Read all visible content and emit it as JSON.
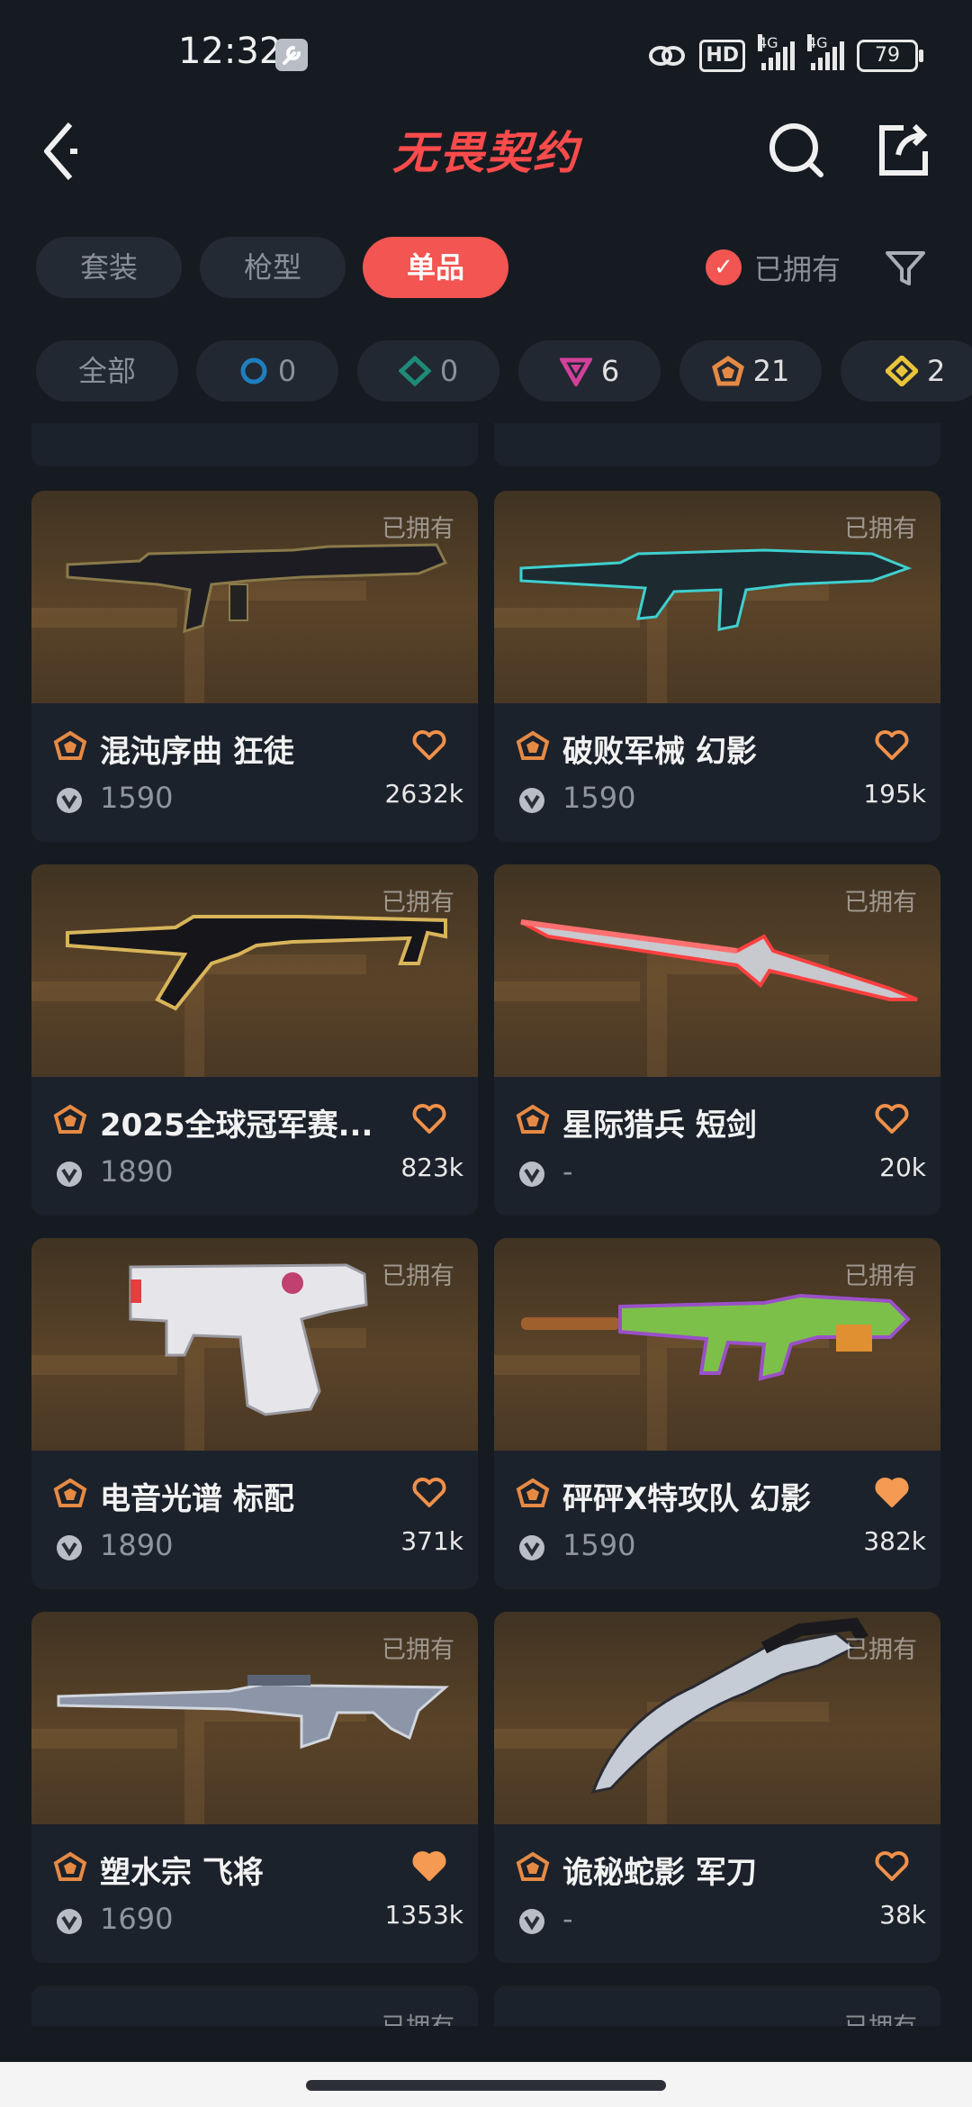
{
  "status": {
    "time": "12:32",
    "hd": "HD",
    "net1": "4G",
    "net2": "4G",
    "battery": "79"
  },
  "nav": {
    "title": "无畏契约"
  },
  "tabs": [
    {
      "label": "套装",
      "active": false
    },
    {
      "label": "枪型",
      "active": false
    },
    {
      "label": "单品",
      "active": true
    }
  ],
  "owned_filter": {
    "label": "已拥有",
    "checked": true
  },
  "tiers": [
    {
      "label": "全部"
    },
    {
      "color": "#1e7fbf",
      "count": "0"
    },
    {
      "color": "#1f8a78",
      "count": "0"
    },
    {
      "color": "#d2409a",
      "count": "6"
    },
    {
      "color": "#e58a45",
      "count": "21"
    },
    {
      "color": "#e8c53a",
      "count": "2"
    }
  ],
  "colors": {
    "accent": "#f35552",
    "heart_outline": "#f0904a",
    "heart_fill": "#f59a52",
    "tier_orange": "#e58a45"
  },
  "cards": [
    {
      "name": "混沌序曲 狂徒",
      "price": "1590",
      "likes": "2632k",
      "owned": "已拥有",
      "favorited": false,
      "weapon": "rifle-dark"
    },
    {
      "name": "破败军械 幻影",
      "price": "1590",
      "likes": "195k",
      "owned": "已拥有",
      "favorited": false,
      "weapon": "rifle-teal"
    },
    {
      "name": "2025全球冠军赛...",
      "price": "1890",
      "likes": "823k",
      "owned": "已拥有",
      "favorited": false,
      "weapon": "rifle-gold"
    },
    {
      "name": "星际猎兵 短剑",
      "price": "-",
      "likes": "20k",
      "owned": "已拥有",
      "favorited": false,
      "weapon": "sword-red"
    },
    {
      "name": "电音光谱 标配",
      "price": "1890",
      "likes": "371k",
      "owned": "已拥有",
      "favorited": false,
      "weapon": "pistol-white"
    },
    {
      "name": "砰砰X特攻队 幻影",
      "price": "1590",
      "likes": "382k",
      "owned": "已拥有",
      "favorited": true,
      "weapon": "rifle-toy"
    },
    {
      "name": "塑水宗 飞将",
      "price": "1690",
      "likes": "1353k",
      "owned": "已拥有",
      "favorited": true,
      "weapon": "sniper-silver"
    },
    {
      "name": "诡秘蛇影 军刀",
      "price": "-",
      "likes": "38k",
      "owned": "已拥有",
      "favorited": false,
      "weapon": "knife-claw"
    }
  ],
  "partial_cards": [
    {
      "owned": "已拥有"
    },
    {
      "owned": "已拥有"
    }
  ]
}
